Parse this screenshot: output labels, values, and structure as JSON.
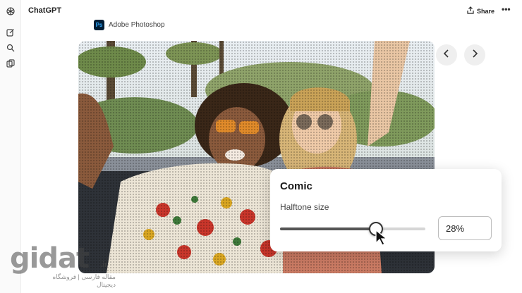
{
  "header": {
    "title": "ChatGPT",
    "share_label": "Share",
    "more_glyph": "•••"
  },
  "sidebar": {
    "icons": [
      "openai-logo-icon",
      "new-chat-icon",
      "search-icon",
      "library-icon"
    ]
  },
  "app_chip": {
    "logo_text": "Ps",
    "label": "Adobe Photoshop",
    "brand_color": "#31a8ff"
  },
  "image": {
    "description_icon": "photo-two-women-convertible-comic-halftone"
  },
  "nav": {
    "prev_icon": "chevron-left-icon",
    "next_icon": "chevron-right-icon"
  },
  "panel": {
    "title": "Comic",
    "control_label": "Halftone size",
    "slider_value": 0.66,
    "value_text": "28%"
  },
  "watermark": {
    "word": "gidat",
    "tld": ".ir",
    "subtitle": "مقاله فارسی | فروشگاه دیجیتال"
  },
  "colors": {
    "accent_ps": "#001e36",
    "panel_bg": "#ffffff",
    "track": "#d6d6d6"
  }
}
